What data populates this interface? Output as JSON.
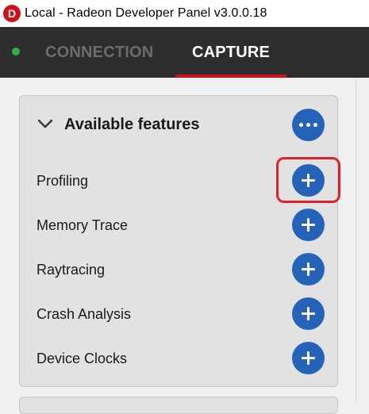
{
  "window": {
    "logo_letter": "D",
    "title": "Local - Radeon Developer Panel v3.0.0.18"
  },
  "tabs": [
    {
      "label": "CONNECTION"
    },
    {
      "label": "CAPTURE"
    }
  ],
  "panel": {
    "title": "Available features",
    "features": [
      {
        "label": "Profiling"
      },
      {
        "label": "Memory Trace"
      },
      {
        "label": "Raytracing"
      },
      {
        "label": "Crash Analysis"
      },
      {
        "label": "Device Clocks"
      }
    ]
  },
  "colors": {
    "accent_blue": "#2563b8",
    "active_tab_underline": "#d0101b",
    "status_connected": "#2fb344",
    "highlight_box": "#e0202a"
  },
  "icons": {
    "status": "status-dot-icon",
    "collapse": "chevron-down-icon",
    "more": "more-dots-icon",
    "add": "plus-icon"
  }
}
